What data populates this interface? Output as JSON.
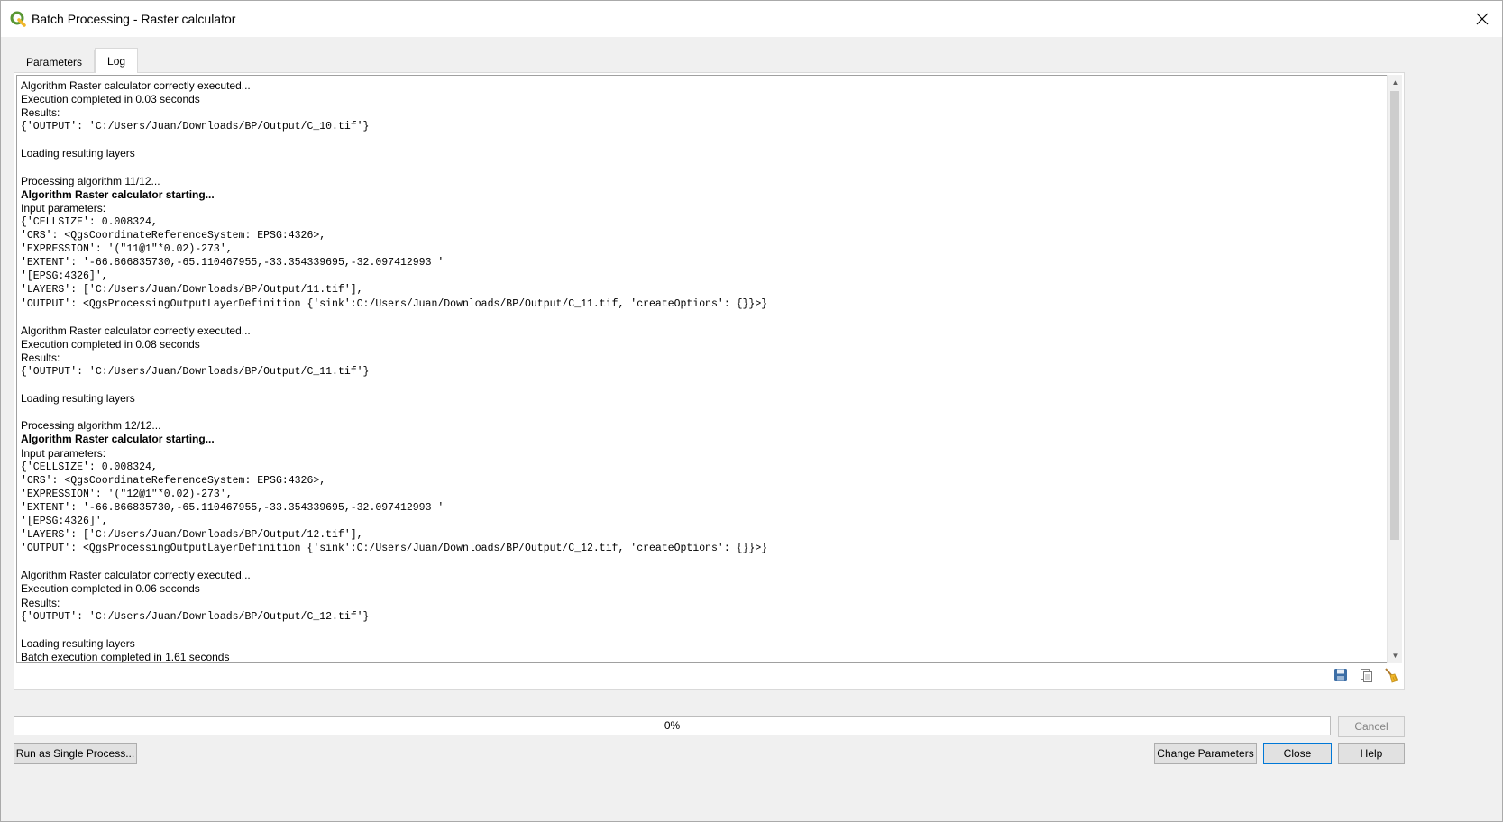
{
  "window": {
    "title": "Batch Processing - Raster calculator"
  },
  "tabs": [
    {
      "label": "Parameters",
      "active": false
    },
    {
      "label": "Log",
      "active": true
    }
  ],
  "log": {
    "lines": [
      {
        "text": "Algorithm Raster calculator correctly executed...",
        "style": "normal"
      },
      {
        "text": "Execution completed in 0.03 seconds",
        "style": "normal"
      },
      {
        "text": "Results:",
        "style": "normal"
      },
      {
        "text": "{'OUTPUT': 'C:/Users/Juan/Downloads/BP/Output/C_10.tif'}",
        "style": "mono"
      },
      {
        "text": "",
        "style": "normal"
      },
      {
        "text": "Loading resulting layers",
        "style": "normal"
      },
      {
        "text": "",
        "style": "normal"
      },
      {
        "text": "Processing algorithm 11/12...",
        "style": "normal"
      },
      {
        "text": "Algorithm Raster calculator starting...",
        "style": "bold"
      },
      {
        "text": "Input parameters:",
        "style": "normal"
      },
      {
        "text": "{'CELLSIZE': 0.008324,",
        "style": "mono"
      },
      {
        "text": "'CRS': <QgsCoordinateReferenceSystem: EPSG:4326>,",
        "style": "mono"
      },
      {
        "text": "'EXPRESSION': '(\"11@1\"*0.02)-273',",
        "style": "mono"
      },
      {
        "text": "'EXTENT': '-66.866835730,-65.110467955,-33.354339695,-32.097412993 '",
        "style": "mono"
      },
      {
        "text": "'[EPSG:4326]',",
        "style": "mono"
      },
      {
        "text": "'LAYERS': ['C:/Users/Juan/Downloads/BP/Output/11.tif'],",
        "style": "mono"
      },
      {
        "text": "'OUTPUT': <QgsProcessingOutputLayerDefinition {'sink':C:/Users/Juan/Downloads/BP/Output/C_11.tif, 'createOptions': {}}>}",
        "style": "mono"
      },
      {
        "text": "",
        "style": "normal"
      },
      {
        "text": "Algorithm Raster calculator correctly executed...",
        "style": "normal"
      },
      {
        "text": "Execution completed in 0.08 seconds",
        "style": "normal"
      },
      {
        "text": "Results:",
        "style": "normal"
      },
      {
        "text": "{'OUTPUT': 'C:/Users/Juan/Downloads/BP/Output/C_11.tif'}",
        "style": "mono"
      },
      {
        "text": "",
        "style": "normal"
      },
      {
        "text": "Loading resulting layers",
        "style": "normal"
      },
      {
        "text": "",
        "style": "normal"
      },
      {
        "text": "Processing algorithm 12/12...",
        "style": "normal"
      },
      {
        "text": "Algorithm Raster calculator starting...",
        "style": "bold"
      },
      {
        "text": "Input parameters:",
        "style": "normal"
      },
      {
        "text": "{'CELLSIZE': 0.008324,",
        "style": "mono"
      },
      {
        "text": "'CRS': <QgsCoordinateReferenceSystem: EPSG:4326>,",
        "style": "mono"
      },
      {
        "text": "'EXPRESSION': '(\"12@1\"*0.02)-273',",
        "style": "mono"
      },
      {
        "text": "'EXTENT': '-66.866835730,-65.110467955,-33.354339695,-32.097412993 '",
        "style": "mono"
      },
      {
        "text": "'[EPSG:4326]',",
        "style": "mono"
      },
      {
        "text": "'LAYERS': ['C:/Users/Juan/Downloads/BP/Output/12.tif'],",
        "style": "mono"
      },
      {
        "text": "'OUTPUT': <QgsProcessingOutputLayerDefinition {'sink':C:/Users/Juan/Downloads/BP/Output/C_12.tif, 'createOptions': {}}>}",
        "style": "mono"
      },
      {
        "text": "",
        "style": "normal"
      },
      {
        "text": "Algorithm Raster calculator correctly executed...",
        "style": "normal"
      },
      {
        "text": "Execution completed in 0.06 seconds",
        "style": "normal"
      },
      {
        "text": "Results:",
        "style": "normal"
      },
      {
        "text": "{'OUTPUT': 'C:/Users/Juan/Downloads/BP/Output/C_12.tif'}",
        "style": "mono"
      },
      {
        "text": "",
        "style": "normal"
      },
      {
        "text": "Loading resulting layers",
        "style": "normal"
      },
      {
        "text": "Batch execution completed in 1.61 seconds",
        "style": "normal"
      }
    ],
    "tools": [
      {
        "icon": "save-icon"
      },
      {
        "icon": "copy-icon"
      },
      {
        "icon": "clear-broom-icon"
      }
    ]
  },
  "progress": {
    "value": 0,
    "label": "0%"
  },
  "buttons": {
    "cancel": "Cancel",
    "run_single": "Run as Single Process...",
    "change_parameters": "Change Parameters",
    "close": "Close",
    "help": "Help"
  },
  "colors": {
    "qgis_green": "#589632",
    "qgis_yellow": "#f0b62a",
    "focus_border": "#0078d7"
  }
}
